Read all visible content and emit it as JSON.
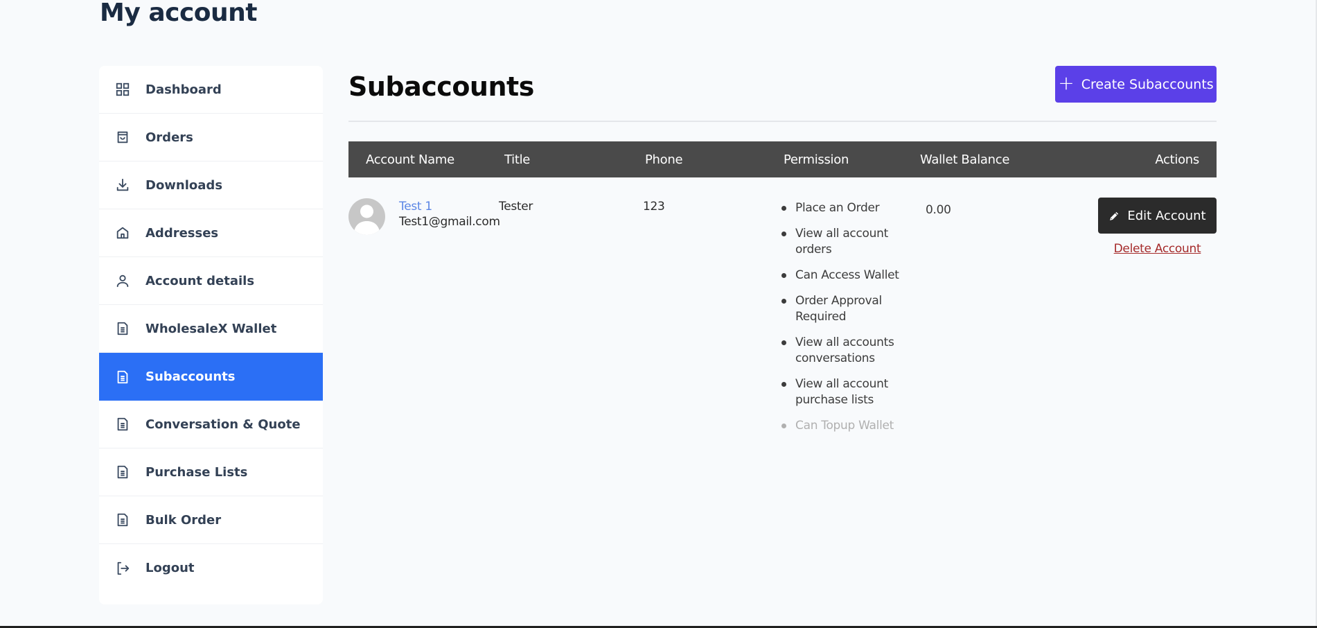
{
  "page": {
    "title": "My account"
  },
  "sidebar": {
    "items": [
      {
        "label": "Dashboard",
        "icon": "dashboard-grid-icon",
        "active": false
      },
      {
        "label": "Orders",
        "icon": "shopping-bag-icon",
        "active": false
      },
      {
        "label": "Downloads",
        "icon": "download-icon",
        "active": false
      },
      {
        "label": "Addresses",
        "icon": "home-icon",
        "active": false
      },
      {
        "label": "Account details",
        "icon": "user-icon",
        "active": false
      },
      {
        "label": "WholesaleX Wallet",
        "icon": "document-icon",
        "active": false
      },
      {
        "label": "Subaccounts",
        "icon": "document-icon",
        "active": true
      },
      {
        "label": "Conversation & Quote",
        "icon": "document-icon",
        "active": false
      },
      {
        "label": "Purchase Lists",
        "icon": "document-icon",
        "active": false
      },
      {
        "label": "Bulk Order",
        "icon": "document-icon",
        "active": false
      },
      {
        "label": "Logout",
        "icon": "logout-icon",
        "active": false
      }
    ]
  },
  "main": {
    "title": "Subaccounts",
    "create_button": {
      "icon": "plus-icon",
      "label": "Create Subaccounts"
    },
    "table": {
      "headers": [
        "Account Name",
        "Title",
        "Phone",
        "Permission",
        "Wallet Balance",
        "Actions"
      ],
      "rows": [
        {
          "name": "Test 1",
          "email": "Test1@gmail.com",
          "title": "Tester",
          "phone": "123",
          "permissions": [
            {
              "label": "Place an Order",
              "enabled": true
            },
            {
              "label": "View all account orders",
              "enabled": true
            },
            {
              "label": "Can Access Wallet",
              "enabled": true
            },
            {
              "label": "Order Approval Required",
              "enabled": true
            },
            {
              "label": "View all accounts conversations",
              "enabled": true
            },
            {
              "label": "View all account purchase lists",
              "enabled": true
            },
            {
              "label": "Can Topup Wallet",
              "enabled": false
            }
          ],
          "wallet_balance": "0.00",
          "edit_label": "Edit Account",
          "delete_label": "Delete Account"
        }
      ]
    }
  },
  "colors": {
    "accent_active": "#2b6ff5",
    "create_button": "#5b40e8",
    "table_header": "#4a4a4a",
    "edit_button": "#2b2b2b",
    "delete_link": "#a52a2a",
    "account_link": "#5b86e5"
  }
}
